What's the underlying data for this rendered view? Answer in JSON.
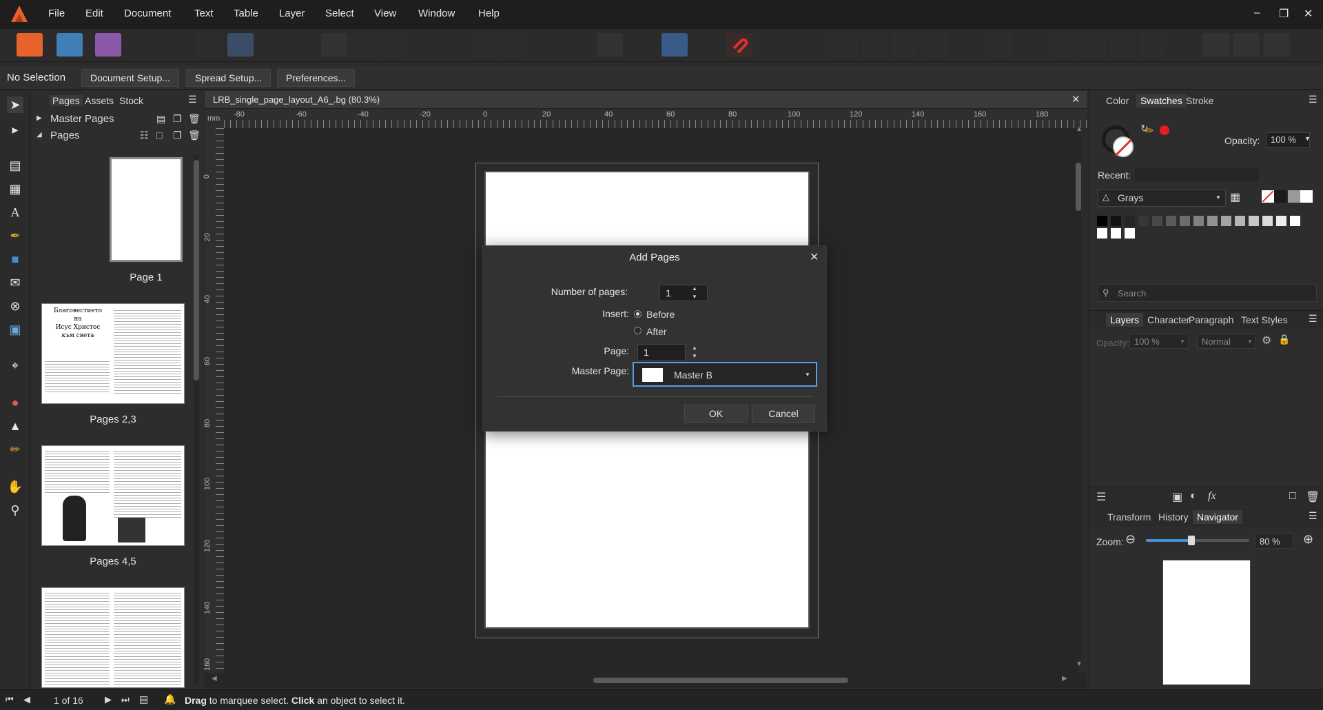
{
  "menu": {
    "items": [
      "File",
      "Edit",
      "Document",
      "Text",
      "Table",
      "Layer",
      "Select",
      "View",
      "Window",
      "Help"
    ]
  },
  "context": {
    "selection": "No Selection",
    "document_setup": "Document Setup...",
    "spread_setup": "Spread Setup...",
    "preferences": "Preferences..."
  },
  "pages_panel": {
    "tabs": [
      "Pages",
      "Assets",
      "Stock"
    ],
    "master_pages": "Master Pages",
    "pages": "Pages",
    "captions": [
      "Page 1",
      "Pages 2,3",
      "Pages 4,5"
    ],
    "thumb_text": {
      "title1": "Благовестието",
      "title2": "на",
      "title3": "Исус Христос",
      "title4": "към света"
    }
  },
  "document": {
    "tab_title": "LRB_single_page_layout_A6_.bg (80.3%)",
    "ruler_unit": "mm",
    "h_ticks": [
      "-80",
      "-60",
      "-40",
      "-20",
      "0",
      "20",
      "40",
      "60",
      "80",
      "100",
      "120",
      "140",
      "160",
      "180"
    ],
    "v_ticks": [
      "0",
      "20",
      "40",
      "60",
      "80",
      "100",
      "120",
      "140",
      "160"
    ]
  },
  "dialog": {
    "title": "Add Pages",
    "number_of_pages_label": "Number of pages:",
    "number_of_pages_value": "1",
    "insert_label": "Insert:",
    "before": "Before",
    "after": "After",
    "page_label": "Page:",
    "page_value": "1",
    "master_page_label": "Master Page:",
    "master_page_value": "Master B",
    "ok": "OK",
    "cancel": "Cancel"
  },
  "right": {
    "tabs_top": [
      "Color",
      "Swatches",
      "Stroke"
    ],
    "opacity_label": "Opacity:",
    "opacity_value": "100 %",
    "recent_label": "Recent:",
    "palette": "Grays",
    "search_placeholder": "Search",
    "tabs_mid": [
      "Layers",
      "Character",
      "Paragraph",
      "Text Styles"
    ],
    "layer_opacity_label": "Opacity:",
    "layer_opacity_value": "100 %",
    "blend_mode": "Normal",
    "tabs_bottom": [
      "Transform",
      "History",
      "Navigator"
    ],
    "zoom_label": "Zoom:",
    "zoom_value": "80 %",
    "zoom_level": 0.8
  },
  "status": {
    "page_counter": "1 of 16",
    "drag_word": "Drag",
    "drag_rest": "to marquee select.",
    "click_word": "Click",
    "click_rest": "an object to select it."
  },
  "colors": {
    "accent": "#4a90d9",
    "app_orange": "#e8632b",
    "dialog_focus": "#5aa0e6"
  }
}
